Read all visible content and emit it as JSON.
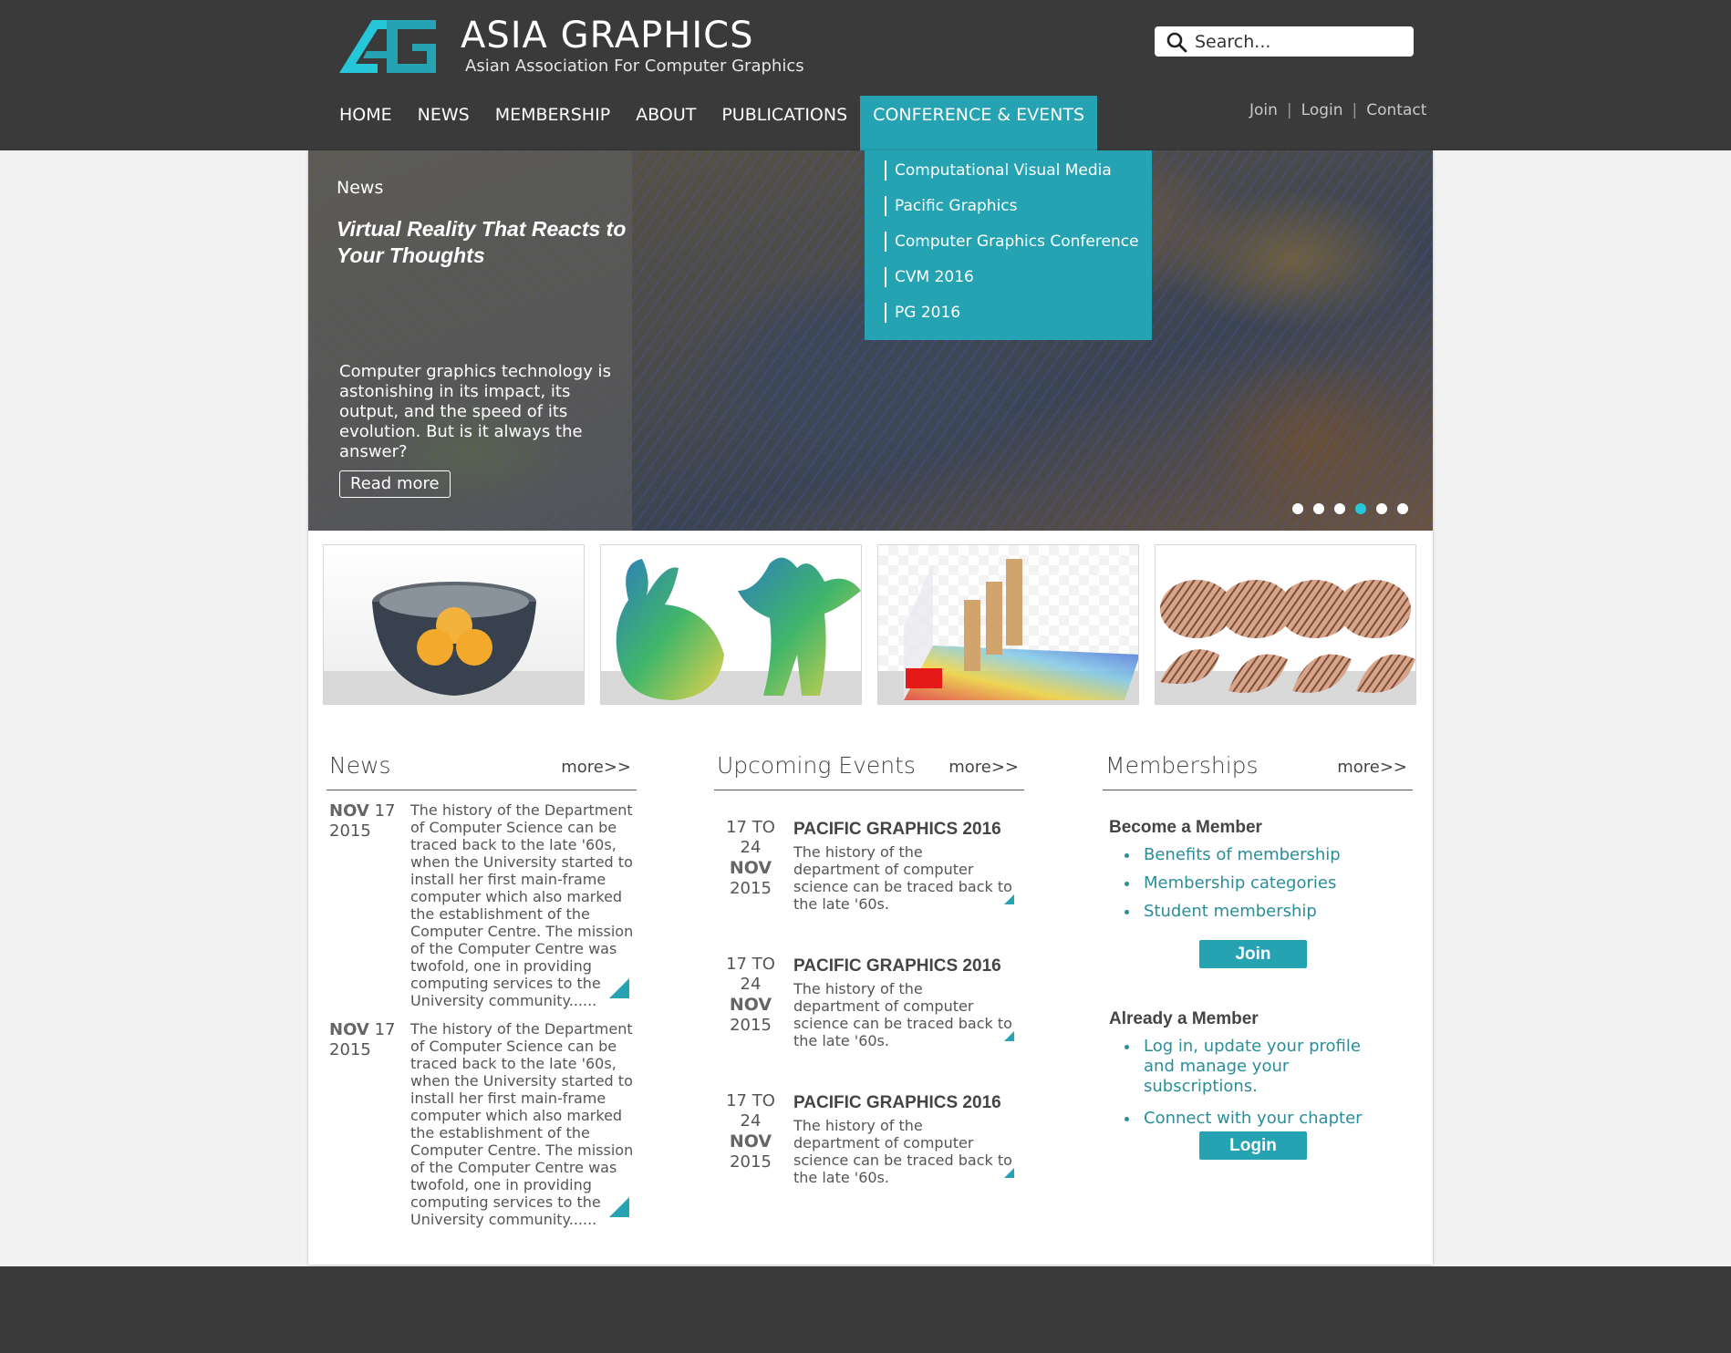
{
  "brand": {
    "title": "ASIA GRAPHICS",
    "subtitle": "Asian Association For Computer Graphics"
  },
  "search": {
    "placeholder": "Search..."
  },
  "nav": {
    "items": [
      {
        "label": "HOME"
      },
      {
        "label": "NEWS"
      },
      {
        "label": "MEMBERSHIP"
      },
      {
        "label": "ABOUT"
      },
      {
        "label": "PUBLICATIONS"
      },
      {
        "label": "CONFERENCE & EVENTS"
      }
    ],
    "active": "CONFERENCE & EVENTS"
  },
  "utility": {
    "join": "Join",
    "sep": "|",
    "login": "Login",
    "contact": "Contact"
  },
  "dropdown": {
    "items": [
      "Computational Visual Media",
      "Pacific Graphics",
      "Computer Graphics Conference",
      "CVM 2016",
      "PG 2016"
    ]
  },
  "hero": {
    "kicker": "News",
    "title": "Virtual Reality That Reacts to Your Thoughts",
    "text": "Computer graphics technology is astonishing in its impact, its output, and the speed of its evolution. But is it always the answer?",
    "button": "Read more",
    "slides_total": 6,
    "slide_active": 4
  },
  "news": {
    "title": "News",
    "more": "more>>",
    "items": [
      {
        "month": "NOV",
        "day": "17",
        "year": "2015",
        "text": "The history of the Department of Computer Science can be traced back to the late '60s, when the University started to install her first main-frame computer which also marked the establishment of the Computer Centre. The mission of the Computer Centre was twofold, one in providing computing services to the University community......"
      },
      {
        "month": "NOV",
        "day": "17",
        "year": "2015",
        "text": "The history of the Department of Computer Science can be traced back to the late '60s, when the University started to install her first main-frame computer which also marked the establishment of the Computer Centre. The mission of the Computer Centre was twofold, one in providing computing services to the University community......"
      }
    ]
  },
  "events": {
    "title": "Upcoming Events",
    "more": "more>>",
    "items": [
      {
        "range": "17 TO",
        "end": "24",
        "month": "NOV",
        "year": "2015",
        "title": "PACIFIC GRAPHICS 2016",
        "text": "The history of the department of computer science can be traced back to the late '60s."
      },
      {
        "range": "17 TO",
        "end": "24",
        "month": "NOV",
        "year": "2015",
        "title": "PACIFIC GRAPHICS 2016",
        "text": "The history of the department of computer science can be traced back to the late '60s."
      },
      {
        "range": "17 TO",
        "end": "24",
        "month": "NOV",
        "year": "2015",
        "title": "PACIFIC GRAPHICS 2016",
        "text": "The history of the department of computer science can be traced back to the late '60s."
      }
    ]
  },
  "memberships": {
    "title": "Memberships",
    "more": "more>>",
    "become": {
      "heading": "Become a Member",
      "links": [
        "Benefits of membership",
        "Membership categories",
        "Student membership"
      ],
      "button": "Join"
    },
    "already": {
      "heading": "Already a Member",
      "links": [
        "Log in, update your profile and manage your subscriptions.",
        "Connect with your chapter"
      ],
      "button": "Login"
    }
  },
  "colors": {
    "header": "#3a3a3a",
    "accent": "#25a3b3",
    "link": "#2a8d9a",
    "dot_active": "#25c7d9"
  }
}
